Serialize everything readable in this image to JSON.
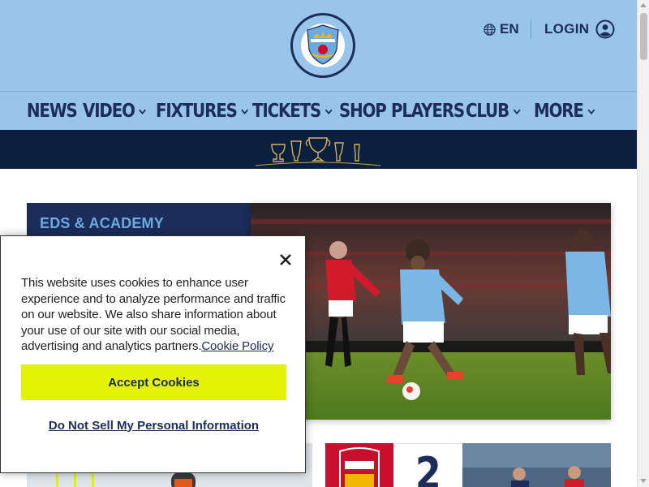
{
  "header": {
    "crest_icon": "man-city-crest",
    "language": {
      "label": "EN",
      "icon": "globe-icon"
    },
    "login": {
      "label": "LOGIN",
      "icon": "user-circle-icon"
    }
  },
  "nav": {
    "items": [
      {
        "label": "NEWS",
        "has_dropdown": false
      },
      {
        "label": "VIDEO",
        "has_dropdown": true
      },
      {
        "label": "FIXTURES",
        "has_dropdown": true
      },
      {
        "label": "TICKETS",
        "has_dropdown": true
      },
      {
        "label": "SHOP",
        "has_dropdown": false
      },
      {
        "label": "PLAYERS",
        "has_dropdown": false
      },
      {
        "label": "CLUB",
        "has_dropdown": true
      },
      {
        "label": "MORE",
        "has_dropdown": true
      }
    ]
  },
  "trophy_banner": {
    "icon": "trophies-icon"
  },
  "hero": {
    "category": "EDS & ACADEMY"
  },
  "cards": {
    "score_value": "2"
  },
  "cookie_banner": {
    "text": "This website uses cookies to enhance user experience and to analyze performance and traffic on our website. We also share information about your use of our site with our social media, advertising and analytics partners.",
    "link_label": "Cookie Policy",
    "accept_label": "Accept Cookies",
    "do_not_sell_label": "Do Not Sell My Personal Information",
    "close_icon": "close-icon"
  },
  "colors": {
    "sky_blue": "#98c5e9",
    "navy": "#1c2c5b",
    "dark_navy": "#0b1f3f",
    "accept_yellow": "#e4f304"
  }
}
